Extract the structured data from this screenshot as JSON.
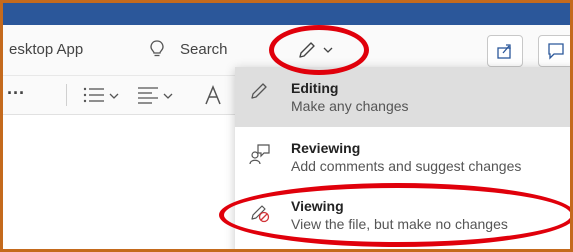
{
  "ribbon": {
    "desktop_app_label": "esktop App",
    "search_label": "Search",
    "more_label": "···"
  },
  "mode_menu": {
    "items": [
      {
        "title": "Editing",
        "description": "Make any changes",
        "icon": "pencil-icon",
        "selected": true
      },
      {
        "title": "Reviewing",
        "description": "Add comments and suggest changes",
        "icon": "reviewing-icon",
        "selected": false
      },
      {
        "title": "Viewing",
        "description": "View the file, but make no changes",
        "icon": "viewing-icon",
        "selected": false
      }
    ]
  },
  "colors": {
    "titlebar": "#2b579a",
    "frame_border": "#c46a1d",
    "annotation": "#e0000b",
    "selected_bg": "#dedede"
  }
}
